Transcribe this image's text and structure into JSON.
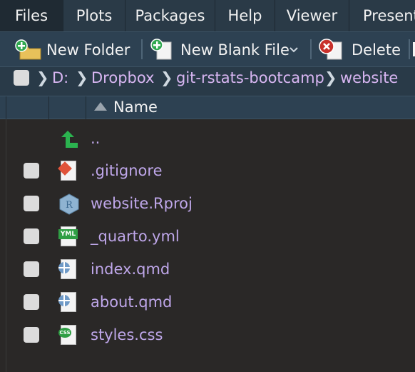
{
  "tabs": [
    "Files",
    "Plots",
    "Packages",
    "Help",
    "Viewer",
    "Present"
  ],
  "toolbar": {
    "new_folder": "New Folder",
    "new_blank_file": "New Blank File",
    "delete": "Delete"
  },
  "breadcrumb": [
    "D:",
    "Dropbox",
    "git-rstats-bootcamp",
    "website"
  ],
  "header": {
    "name": "Name"
  },
  "files": [
    {
      "name": "..",
      "icon": "parent-folder-icon"
    },
    {
      "name": ".gitignore",
      "icon": "git-file-icon"
    },
    {
      "name": "website.Rproj",
      "icon": "rproj-icon"
    },
    {
      "name": "_quarto.yml",
      "icon": "yml-icon"
    },
    {
      "name": "index.qmd",
      "icon": "quarto-icon"
    },
    {
      "name": "about.qmd",
      "icon": "quarto-icon"
    },
    {
      "name": "styles.css",
      "icon": "css-icon"
    }
  ],
  "colors": {
    "tabbar": "#2a3a47",
    "toolbar": "#2d4152",
    "file_link": "#bfa7ea",
    "background": "#2a2827"
  }
}
